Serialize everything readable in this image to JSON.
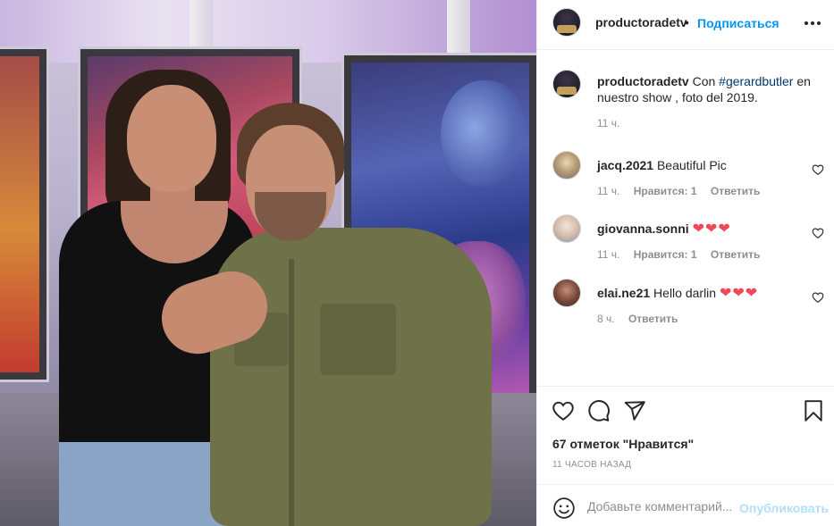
{
  "post_image": {
    "icon": "photo-image"
  },
  "header": {
    "username": "productoradetv",
    "separator": "•",
    "follow_label": "Подписаться",
    "more_icon": "more-horizontal-icon"
  },
  "caption": {
    "username": "productoradetv",
    "text_before": "Con ",
    "hashtag": "#gerardbutler",
    "text_after": " en nuestro show , foto del 2019.",
    "time": "11 ч."
  },
  "comments": [
    {
      "username": "jacq.2021",
      "text": "Beautiful Pic",
      "hearts": "",
      "time": "11 ч.",
      "likes": "Нравится: 1",
      "reply": "Ответить"
    },
    {
      "username": "giovanna.sonni",
      "text": "",
      "hearts": "❤❤❤",
      "time": "11 ч.",
      "likes": "Нравится: 1",
      "reply": "Ответить"
    },
    {
      "username": "elai.ne21",
      "text": "Hello darlin",
      "hearts": "❤❤❤",
      "time": "8 ч.",
      "likes": "",
      "reply": "Ответить"
    }
  ],
  "actions": {
    "likes_text": "67 отметок \"Нравится\"",
    "time_ago": "11 ЧАСОВ НАЗАД"
  },
  "add_comment": {
    "placeholder": "Добавьте комментарий...",
    "post_label": "Опубликовать"
  },
  "colors": {
    "link": "#0095f6",
    "hashtag": "#00376b",
    "muted": "#8e8e8e",
    "heart": "#ed4956"
  }
}
